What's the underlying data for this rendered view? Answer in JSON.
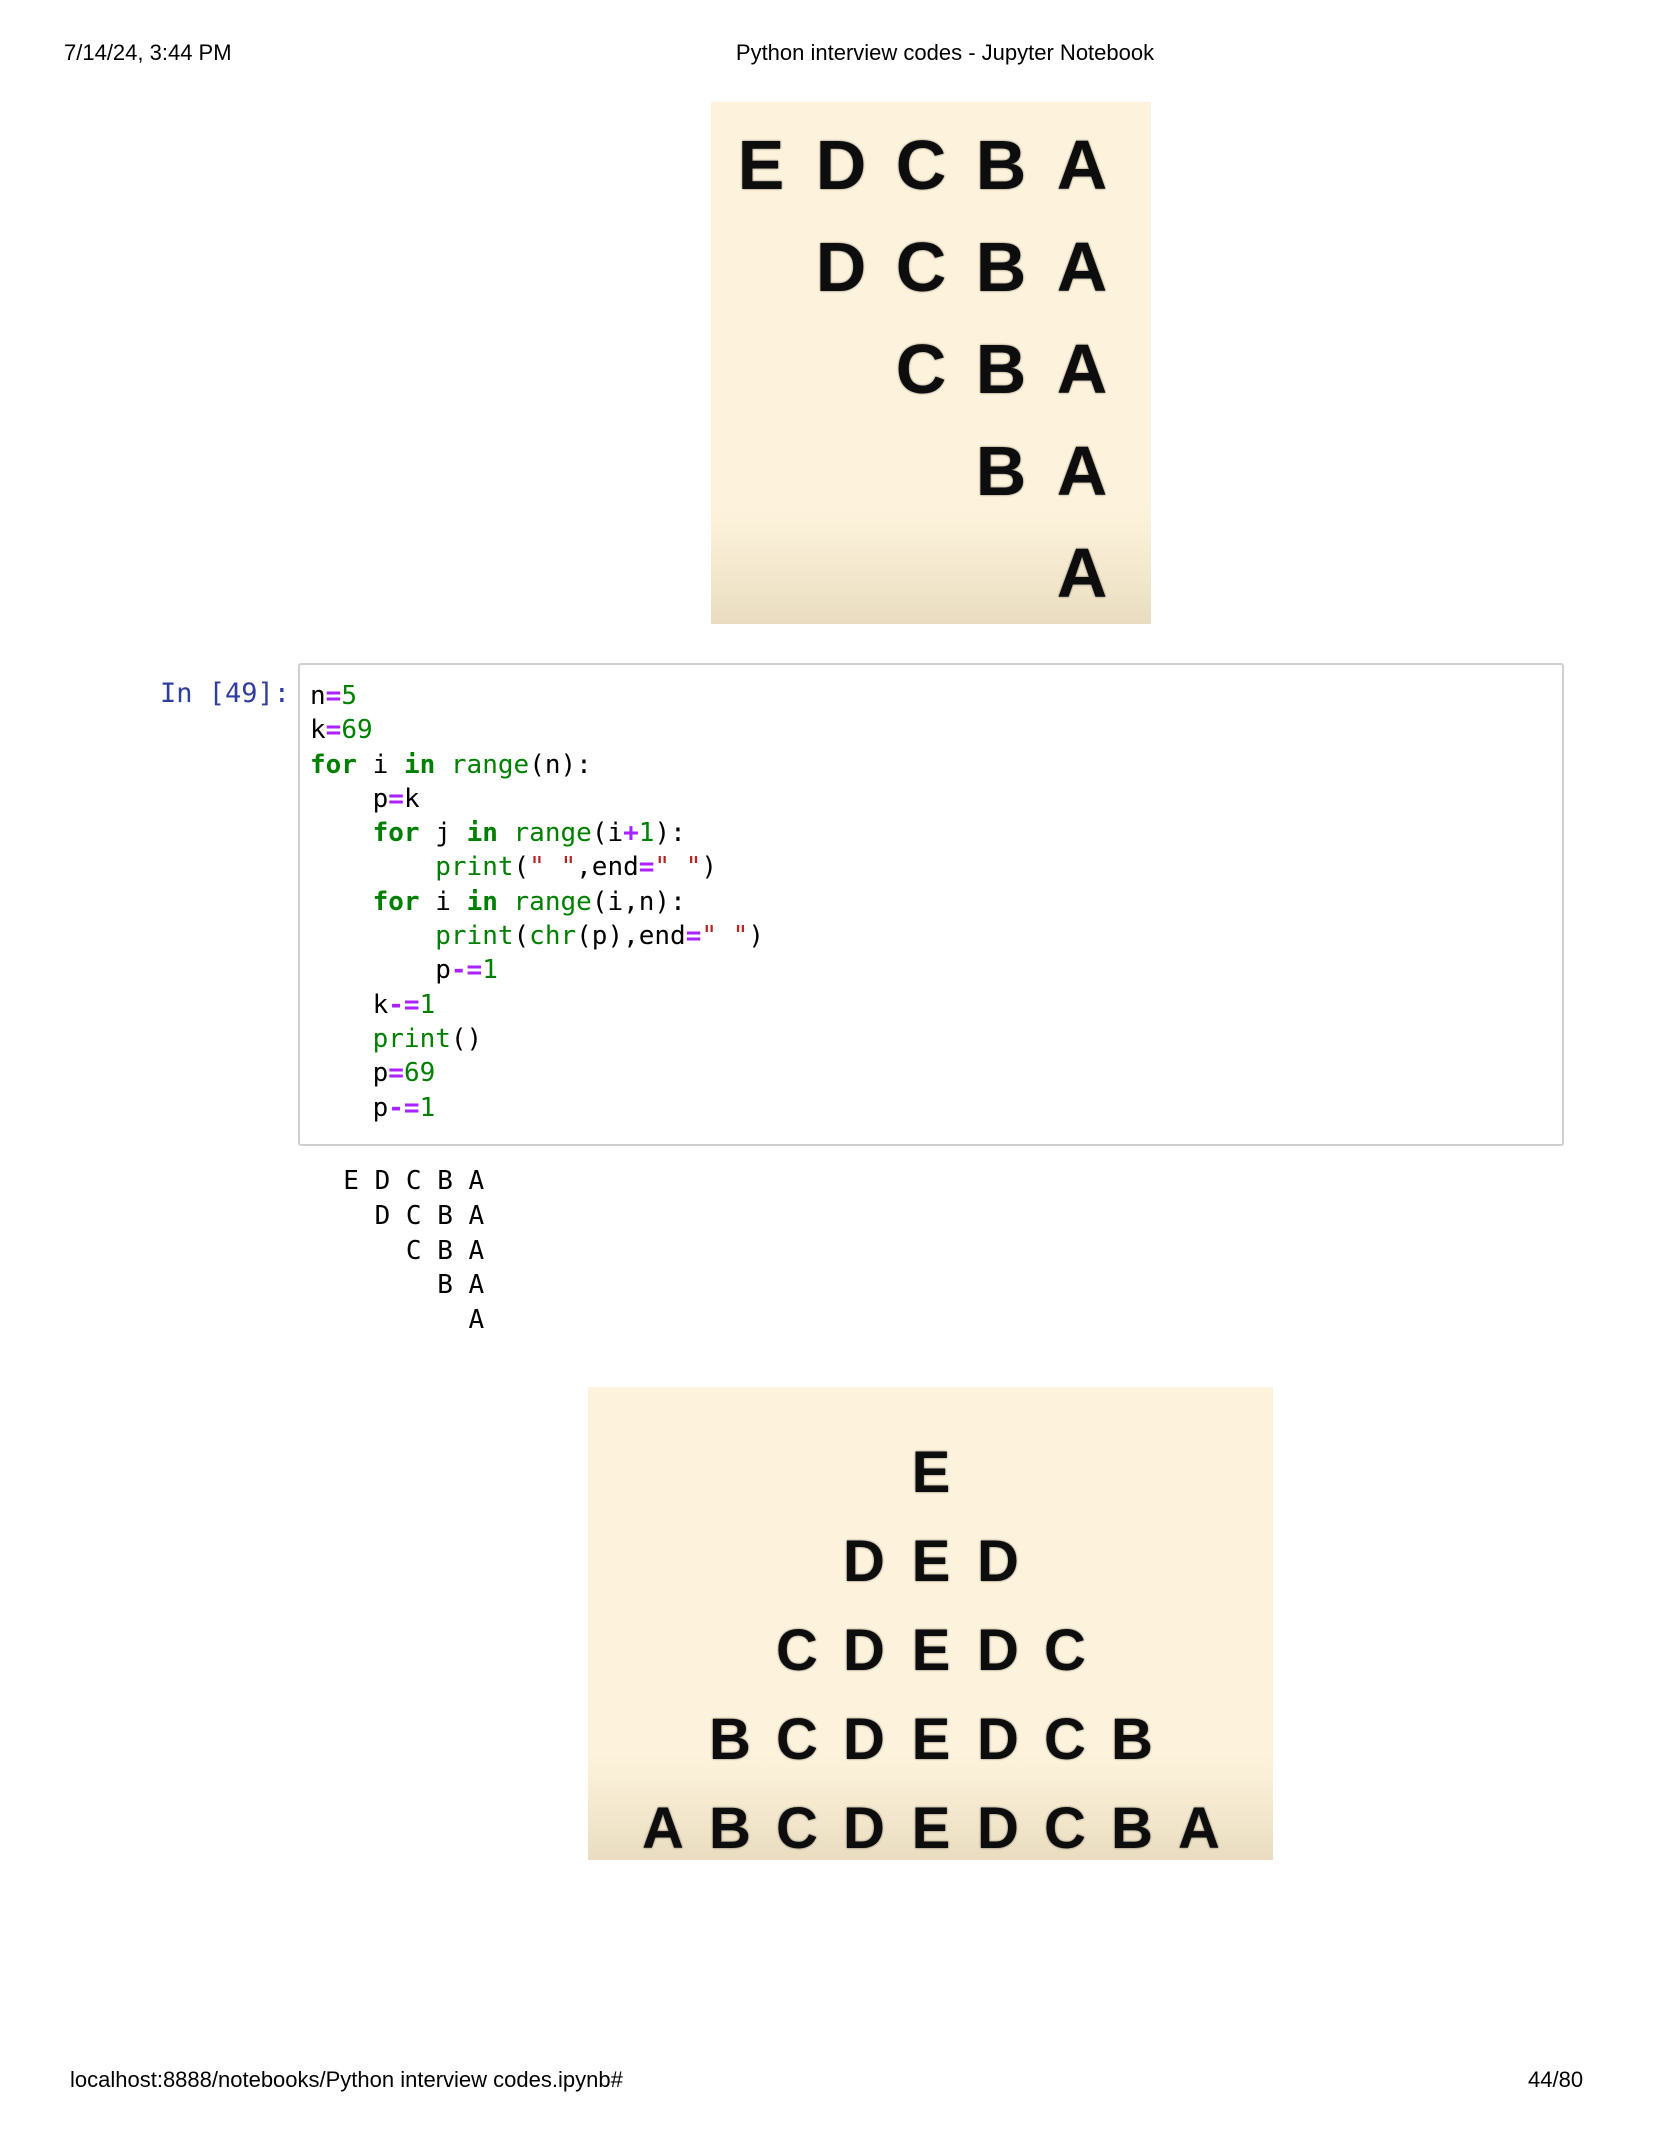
{
  "header": {
    "datetime": "7/14/24, 3:44 PM",
    "title": "Python interview codes - Jupyter Notebook"
  },
  "footer": {
    "url": "localhost:8888/notebooks/Python interview codes.ipynb#",
    "page": "44/80"
  },
  "pattern_image_1": {
    "rows": [
      [
        "E",
        "D",
        "C",
        "B",
        "A"
      ],
      [
        "D",
        "C",
        "B",
        "A"
      ],
      [
        "C",
        "B",
        "A"
      ],
      [
        "B",
        "A"
      ],
      [
        "A"
      ]
    ]
  },
  "cell": {
    "prompt": "In [49]:",
    "code_lines": [
      "n=5",
      "k=69",
      "for i in range(n):",
      "    p=k",
      "    for j in range(i+1):",
      "        print(\" \",end=\" \")",
      "    for i in range(i,n):",
      "        print(chr(p),end=\" \")",
      "        p-=1",
      "    k-=1",
      "    print()",
      "    p=69",
      "    p-=1"
    ],
    "output_lines": [
      "  E D C B A ",
      "    D C B A ",
      "      C B A ",
      "        B A ",
      "          A "
    ]
  },
  "pattern_image_2": {
    "rows": [
      [
        "E"
      ],
      [
        "D",
        "E",
        "D"
      ],
      [
        "C",
        "D",
        "E",
        "D",
        "C"
      ],
      [
        "B",
        "C",
        "D",
        "E",
        "D",
        "C",
        "B"
      ],
      [
        "A",
        "B",
        "C",
        "D",
        "E",
        "D",
        "C",
        "B",
        "A"
      ]
    ]
  }
}
